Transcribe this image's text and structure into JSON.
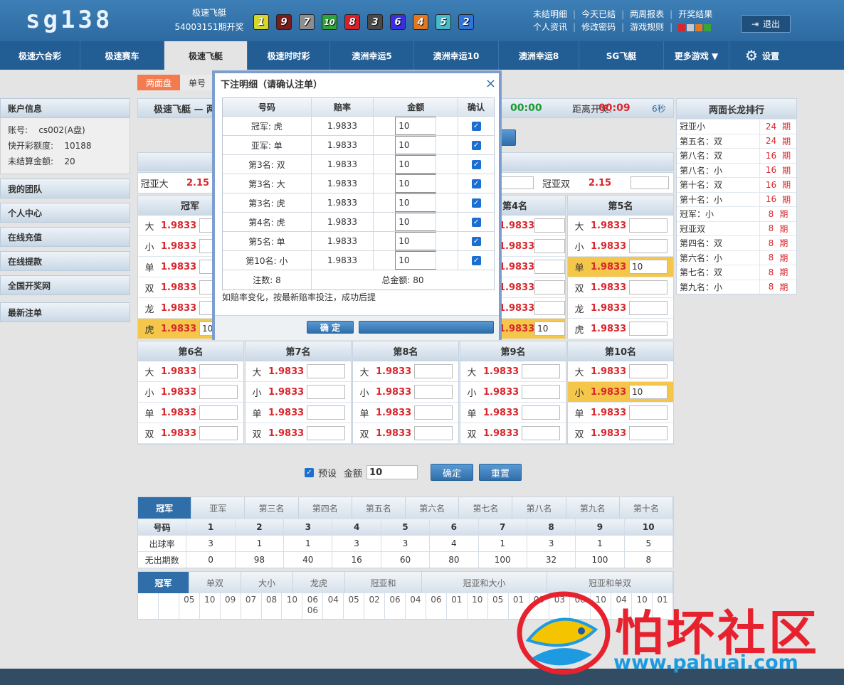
{
  "header": {
    "logo": "sg138",
    "game_name": "极速飞艇",
    "period": "54003151期开奖",
    "balls": [
      {
        "n": "1",
        "color": "#d7d62a"
      },
      {
        "n": "9",
        "color": "#7a1c1c"
      },
      {
        "n": "7",
        "color": "#8e8e8e"
      },
      {
        "n": "10",
        "color": "#2fa33a"
      },
      {
        "n": "8",
        "color": "#d6202a"
      },
      {
        "n": "3",
        "color": "#4a4a4a"
      },
      {
        "n": "6",
        "color": "#3b2ee0"
      },
      {
        "n": "4",
        "color": "#e2771f"
      },
      {
        "n": "5",
        "color": "#47b9c9"
      },
      {
        "n": "2",
        "color": "#2f74d9"
      }
    ],
    "links_row1": [
      "未结明细",
      "今天已结",
      "两周报表",
      "开奖结果"
    ],
    "links_row2": [
      "个人资讯",
      "修改密码",
      "游戏规则"
    ],
    "logout": "退出"
  },
  "nav": [
    "极速六合彩",
    "极速赛车",
    "极速飞艇",
    "极速时时彩",
    "澳洲幸运5",
    "澳洲幸运10",
    "澳洲幸运8",
    "SG飞艇",
    "更多游戏 ▼",
    "设置"
  ],
  "subtabs": [
    "两面盘",
    "单号"
  ],
  "sidebar": {
    "account_title": "账户信息",
    "account_label": "账号:",
    "account_value": "cs002(A盘)",
    "credit_label": "快开彩额度:",
    "credit_value": "10188",
    "unsettled_label": "未结算金额:",
    "unsettled_value": "20",
    "items": [
      "我的团队",
      "个人中心",
      "在线充值",
      "在线提款",
      "全国开奖网",
      "最新注单"
    ]
  },
  "main": {
    "title_left": "极速飞艇 — 两",
    "timer1": "00:00",
    "draw_label": "距离开奖:",
    "timer2": "00:09",
    "refresh": "6秒",
    "sum_left_name": "冠亚大",
    "sum_left_odds": "2.15",
    "sum_right_name": "冠亚双",
    "sum_right_odds": "2.15"
  },
  "col1": {
    "title": "冠军",
    "rows": [
      {
        "name": "大",
        "odds": "1.9833",
        "val": ""
      },
      {
        "name": "小",
        "odds": "1.9833",
        "val": ""
      },
      {
        "name": "单",
        "odds": "1.9833",
        "val": ""
      },
      {
        "name": "双",
        "odds": "1.9833",
        "val": ""
      },
      {
        "name": "龙",
        "odds": "1.9833",
        "val": ""
      },
      {
        "name": "虎",
        "odds": "1.9833",
        "val": "10"
      }
    ]
  },
  "col4": {
    "title": "第4名",
    "rows": [
      {
        "odds": "1.9833",
        "val": ""
      },
      {
        "odds": "1.9833",
        "val": ""
      },
      {
        "odds": "1.9833",
        "val": ""
      },
      {
        "odds": "1.9833",
        "val": ""
      },
      {
        "odds": "1.9833",
        "val": ""
      },
      {
        "odds": "1.9833",
        "val": "10"
      }
    ]
  },
  "col5": {
    "title": "第5名",
    "rows": [
      {
        "name": "大",
        "odds": "1.9833",
        "val": ""
      },
      {
        "name": "小",
        "odds": "1.9833",
        "val": ""
      },
      {
        "name": "单",
        "odds": "1.9833",
        "val": "10"
      },
      {
        "name": "双",
        "odds": "1.9833",
        "val": ""
      },
      {
        "name": "龙",
        "odds": "1.9833",
        "val": ""
      },
      {
        "name": "虎",
        "odds": "1.9833",
        "val": ""
      }
    ]
  },
  "lower": [
    {
      "title": "第6名",
      "rows": [
        {
          "name": "大",
          "odds": "1.9833",
          "val": ""
        },
        {
          "name": "小",
          "odds": "1.9833",
          "val": ""
        },
        {
          "name": "单",
          "odds": "1.9833",
          "val": ""
        },
        {
          "name": "双",
          "odds": "1.9833",
          "val": ""
        }
      ]
    },
    {
      "title": "第7名",
      "rows": [
        {
          "name": "大",
          "odds": "1.9833",
          "val": ""
        },
        {
          "name": "小",
          "odds": "1.9833",
          "val": ""
        },
        {
          "name": "单",
          "odds": "1.9833",
          "val": ""
        },
        {
          "name": "双",
          "odds": "1.9833",
          "val": ""
        }
      ]
    },
    {
      "title": "第8名",
      "rows": [
        {
          "name": "大",
          "odds": "1.9833",
          "val": ""
        },
        {
          "name": "小",
          "odds": "1.9833",
          "val": ""
        },
        {
          "name": "单",
          "odds": "1.9833",
          "val": ""
        },
        {
          "name": "双",
          "odds": "1.9833",
          "val": ""
        }
      ]
    },
    {
      "title": "第9名",
      "rows": [
        {
          "name": "大",
          "odds": "1.9833",
          "val": ""
        },
        {
          "name": "小",
          "odds": "1.9833",
          "val": ""
        },
        {
          "name": "单",
          "odds": "1.9833",
          "val": ""
        },
        {
          "name": "双",
          "odds": "1.9833",
          "val": ""
        }
      ]
    },
    {
      "title": "第10名",
      "rows": [
        {
          "name": "大",
          "odds": "1.9833",
          "val": ""
        },
        {
          "name": "小",
          "odds": "1.9833",
          "val": "10"
        },
        {
          "name": "单",
          "odds": "1.9833",
          "val": ""
        },
        {
          "name": "双",
          "odds": "1.9833",
          "val": ""
        }
      ]
    }
  ],
  "longdragon": {
    "title": "两面长龙排行",
    "unit": "期",
    "rows": [
      {
        "name": "冠亚小",
        "count": "24"
      },
      {
        "name": "第五名：双",
        "count": "24"
      },
      {
        "name": "第八名：双",
        "count": "16"
      },
      {
        "name": "第八名：小",
        "count": "16"
      },
      {
        "name": "第十名：双",
        "count": "16"
      },
      {
        "name": "第十名：小",
        "count": "16"
      },
      {
        "name": "冠军：小",
        "count": "8"
      },
      {
        "name": "冠亚双",
        "count": "8"
      },
      {
        "name": "第四名：双",
        "count": "8"
      },
      {
        "name": "第六名：小",
        "count": "8"
      },
      {
        "name": "第七名：双",
        "count": "8"
      },
      {
        "name": "第九名：小",
        "count": "8"
      }
    ]
  },
  "preset": {
    "label": "预设",
    "amount_label": "金额",
    "amount": "10",
    "confirm": "确定",
    "reset": "重置"
  },
  "stats": {
    "tabs": [
      "冠军",
      "亚军",
      "第三名",
      "第四名",
      "第五名",
      "第六名",
      "第七名",
      "第八名",
      "第九名",
      "第十名"
    ],
    "header": [
      "号码",
      "1",
      "2",
      "3",
      "4",
      "5",
      "6",
      "7",
      "8",
      "9",
      "10"
    ],
    "rate_row": [
      "出球率",
      "3",
      "1",
      "1",
      "3",
      "3",
      "4",
      "1",
      "3",
      "1",
      "5"
    ],
    "miss_row": [
      "无出期数",
      "0",
      "98",
      "40",
      "16",
      "60",
      "80",
      "100",
      "32",
      "100",
      "8"
    ]
  },
  "road": {
    "tabs": [
      "冠军",
      "单双",
      "大小",
      "龙虎",
      "冠亚和",
      "冠亚和大小",
      "冠亚和单双"
    ],
    "cells": [
      "",
      "",
      "05",
      "10",
      "09",
      "07",
      "08",
      "10",
      "06\n06",
      "04",
      "05",
      "02",
      "06",
      "04",
      "06",
      "01",
      "10",
      "05",
      "01",
      "09",
      "03",
      "08",
      "10",
      "04",
      "10",
      "01"
    ]
  },
  "modal": {
    "title": "下注明细（请确认注单）",
    "close": "×",
    "headers": [
      "号码",
      "赔率",
      "金额",
      "确认"
    ],
    "rows": [
      {
        "name": "冠军: 虎",
        "odds": "1.9833",
        "amount": "10"
      },
      {
        "name": "亚军: 单",
        "odds": "1.9833",
        "amount": "10"
      },
      {
        "name": "第3名: 双",
        "odds": "1.9833",
        "amount": "10"
      },
      {
        "name": "第3名: 大",
        "odds": "1.9833",
        "amount": "10"
      },
      {
        "name": "第3名: 虎",
        "odds": "1.9833",
        "amount": "10"
      },
      {
        "name": "第4名: 虎",
        "odds": "1.9833",
        "amount": "10"
      },
      {
        "name": "第5名: 单",
        "odds": "1.9833",
        "amount": "10"
      },
      {
        "name": "第10名: 小",
        "odds": "1.9833",
        "amount": "10"
      }
    ],
    "count_label": "注数: 8",
    "total_label": "总金额: 80",
    "note": "如赔率变化，按最新赔率投注，成功后提",
    "confirm": "确 定"
  },
  "watermark": {
    "text": "怕坏社区",
    "url": "www.pahuai.com"
  }
}
